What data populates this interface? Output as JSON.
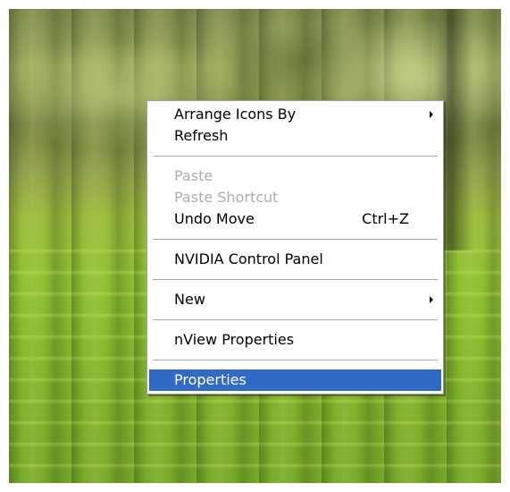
{
  "context_menu": {
    "items": [
      {
        "label": "Arrange Icons By"
      },
      {
        "label": "Refresh"
      },
      {
        "label": "Paste"
      },
      {
        "label": "Paste Shortcut"
      },
      {
        "label": "Undo Move",
        "shortcut": "Ctrl+Z"
      },
      {
        "label": "NVIDIA Control Panel"
      },
      {
        "label": "New"
      },
      {
        "label": "nView Properties"
      },
      {
        "label": "Properties"
      }
    ],
    "disabled_items": [
      "Paste",
      "Paste Shortcut"
    ],
    "selected_item": "Properties",
    "submenu_items": [
      "Arrange Icons By",
      "New"
    ],
    "highlight_color": "#316ac5",
    "disabled_color": "#acacac"
  }
}
